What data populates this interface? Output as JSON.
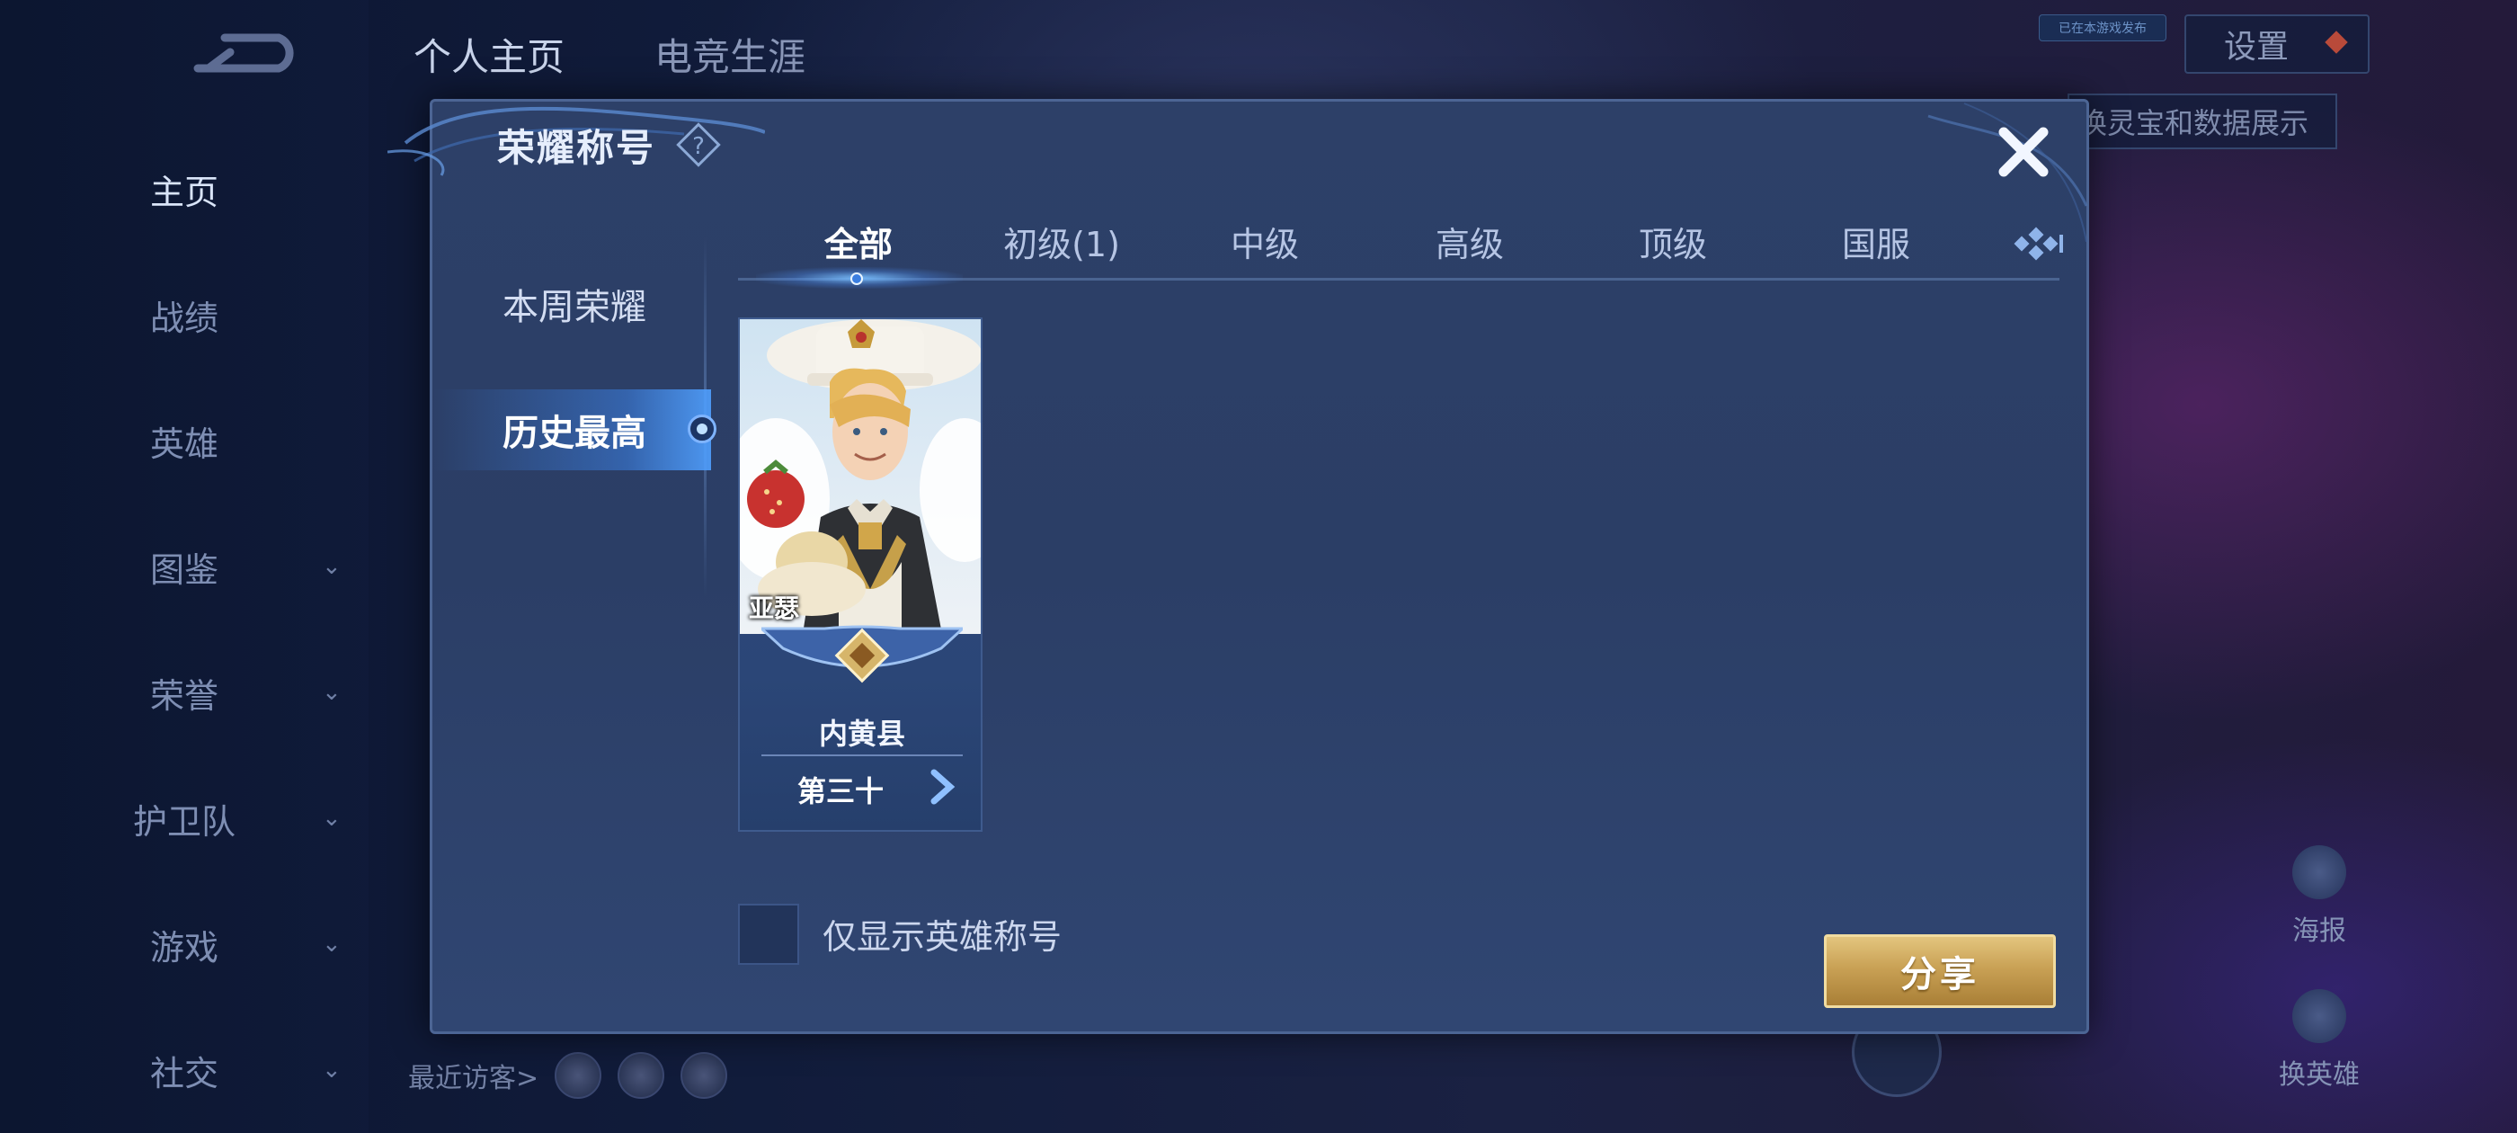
{
  "background": {
    "nav": [
      {
        "label": "主页",
        "active": true,
        "chevron": false
      },
      {
        "label": "战绩",
        "active": false,
        "chevron": false
      },
      {
        "label": "英雄",
        "active": false,
        "chevron": false
      },
      {
        "label": "图鉴",
        "active": false,
        "chevron": true
      },
      {
        "label": "荣誉",
        "active": false,
        "chevron": true
      },
      {
        "label": "护卫队",
        "active": false,
        "chevron": true
      },
      {
        "label": "游戏",
        "active": false,
        "chevron": true
      },
      {
        "label": "社交",
        "active": false,
        "chevron": true
      }
    ],
    "header_tabs": [
      "个人主页",
      "电竞生涯"
    ],
    "badge": "已在本游戏发布",
    "settings_label": "设置",
    "lingbao_label": "换灵宝和数据展示",
    "poster_label": "海报",
    "swap_hero_label": "换英雄",
    "recent_visitors_label": "最近访客>"
  },
  "modal": {
    "title": "荣耀称号",
    "left_menu": [
      {
        "label": "本周荣耀",
        "active": false
      },
      {
        "label": "历史最高",
        "active": true
      }
    ],
    "tabs": [
      {
        "label": "全部",
        "active": true
      },
      {
        "label": "初级(1)",
        "active": false
      },
      {
        "label": "中级",
        "active": false
      },
      {
        "label": "高级",
        "active": false
      },
      {
        "label": "顶级",
        "active": false
      },
      {
        "label": "国服",
        "active": false
      }
    ],
    "cards": [
      {
        "hero": "亚瑟",
        "region": "内黄县",
        "rank": "第三十"
      }
    ],
    "checkbox_label": "仅显示英雄称号",
    "checkbox_checked": false,
    "share_label": "分享"
  }
}
